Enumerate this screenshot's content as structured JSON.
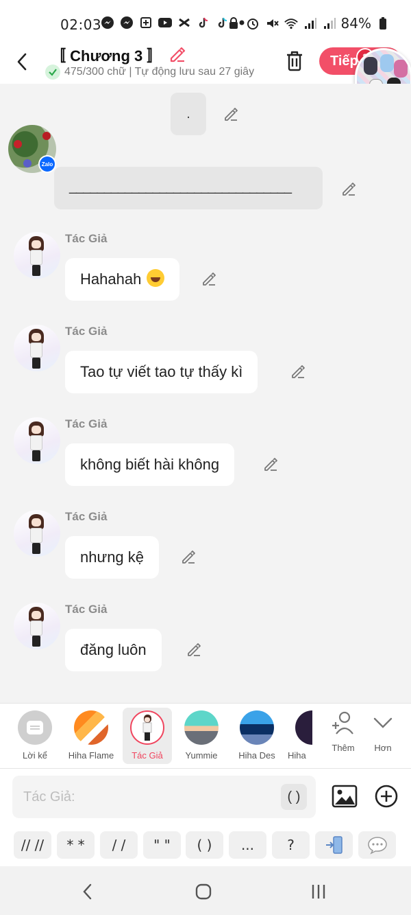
{
  "status_bar": {
    "time": "02:03",
    "battery": "84%",
    "icons": [
      "messenger-icon",
      "messenger-icon",
      "app-icon",
      "youtube-icon",
      "capcut-icon",
      "tiktok-icon",
      "tiktok-icon",
      "dot-icon"
    ],
    "right_icons": [
      "lock-icon",
      "alarm-icon",
      "mute-icon",
      "wifi-icon",
      "signal-icon",
      "signal-icon"
    ]
  },
  "header": {
    "title": "〚 Chương 3 〛",
    "subtitle": "475/300 chữ | Tự động lưu sau 27 giây",
    "next_label": "Tiếp",
    "notif_count": "2"
  },
  "chat": {
    "dot_message": ".",
    "line_message": "________________________________",
    "messages": [
      {
        "author": "Tác Giả",
        "text": "Hahahah",
        "emoji": "rofl-emoji"
      },
      {
        "author": "Tác Giả",
        "text": "Tao tự viết tao tự thấy kì"
      },
      {
        "author": "Tác Giả",
        "text": "không biết hài không"
      },
      {
        "author": "Tác Giả",
        "text": "nhưng kệ"
      },
      {
        "author": "Tác Giả",
        "text": "đăng luôn"
      }
    ],
    "zalo_badge": "Zalo"
  },
  "characters": {
    "items": [
      {
        "name": "Lời kể"
      },
      {
        "name": "Hiha Flame"
      },
      {
        "name": "Tác Giả",
        "selected": true
      },
      {
        "name": "Yummie"
      },
      {
        "name": "Hiha Des"
      },
      {
        "name": "Hiha"
      }
    ],
    "add_label": "Thêm",
    "more_label": "Hơn"
  },
  "input": {
    "placeholder": "Tác Giả:",
    "paren_label": "( )"
  },
  "symbols": [
    "// //",
    "* *",
    "/ /",
    "\" \"",
    "( )",
    "...",
    "?"
  ],
  "colors": {
    "accent": "#f24f68",
    "bubble": "#ffffff",
    "background": "#f3f3f3"
  }
}
